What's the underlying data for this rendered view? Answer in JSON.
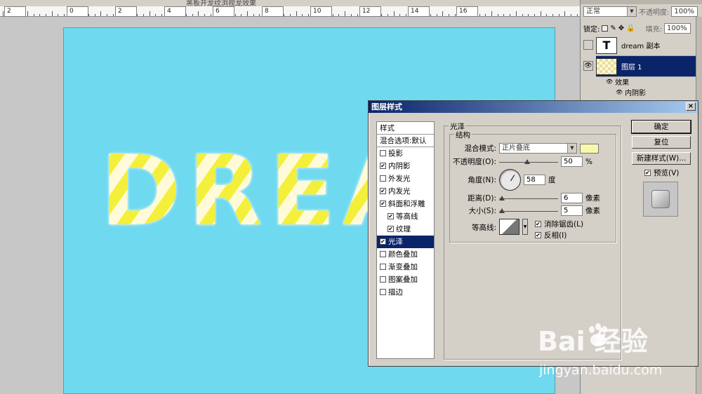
{
  "window": {
    "title_partial": "黑板开龙纹浏视龙效果"
  },
  "ruler": {
    "labels": [
      "2",
      "0",
      "2",
      "4",
      "6",
      "8",
      "10",
      "12",
      "14",
      "16"
    ]
  },
  "canvas": {
    "text": "DREAM",
    "bg_color": "#6fd9ef",
    "stripe_colors": [
      "#f4ef3b",
      "#fffbd8"
    ]
  },
  "layers_panel": {
    "blend_mode": "正常",
    "opacity_label": "不透明度:",
    "opacity_value": "100%",
    "lock_label": "锁定:",
    "fill_label": "填充:",
    "fill_value": "100%",
    "layers": [
      {
        "name": "dream 副本",
        "thumb": "T",
        "visible": false,
        "active": false
      },
      {
        "name": "图层 1",
        "thumb": "",
        "visible": true,
        "active": true
      }
    ],
    "effects_label": "效果",
    "effects": [
      "内阴影"
    ]
  },
  "dialog": {
    "title": "图层样式",
    "close": "×",
    "styles": [
      {
        "label": "样式",
        "type": "header"
      },
      {
        "label": "混合选项:默认",
        "type": "header"
      },
      {
        "label": "投影",
        "checked": false
      },
      {
        "label": "内阴影",
        "checked": true
      },
      {
        "label": "外发光",
        "checked": false
      },
      {
        "label": "内发光",
        "checked": true
      },
      {
        "label": "斜面和浮雕",
        "checked": true
      },
      {
        "label": "等高线",
        "checked": true,
        "sub": true
      },
      {
        "label": "纹理",
        "checked": true,
        "sub": true
      },
      {
        "label": "光泽",
        "checked": true,
        "active": true
      },
      {
        "label": "颜色叠加",
        "checked": false
      },
      {
        "label": "渐变叠加",
        "checked": false
      },
      {
        "label": "图案叠加",
        "checked": false
      },
      {
        "label": "描边",
        "checked": false
      }
    ],
    "section_title": "光泽",
    "group_title": "结构",
    "blend_mode_label": "混合模式:",
    "blend_mode_value": "正片叠底",
    "blend_color": "#f7f8aa",
    "opacity_label": "不透明度(O):",
    "opacity_value": "50",
    "opacity_unit": "%",
    "angle_label": "角度(N):",
    "angle_value": "58",
    "angle_unit": "度",
    "distance_label": "距离(D):",
    "distance_value": "6",
    "distance_unit": "像素",
    "size_label": "大小(S):",
    "size_value": "5",
    "size_unit": "像素",
    "contour_label": "等高线:",
    "antialias_label": "消除锯齿(L)",
    "antialias_checked": true,
    "invert_label": "反相(I)",
    "invert_checked": true,
    "buttons": {
      "ok": "确定",
      "reset": "复位",
      "new_style": "新建样式(W)...",
      "preview": "预览(V)"
    },
    "preview_checked": true
  },
  "watermark": {
    "brand": "Bai  经验",
    "url": "jingyan.baidu.com"
  }
}
